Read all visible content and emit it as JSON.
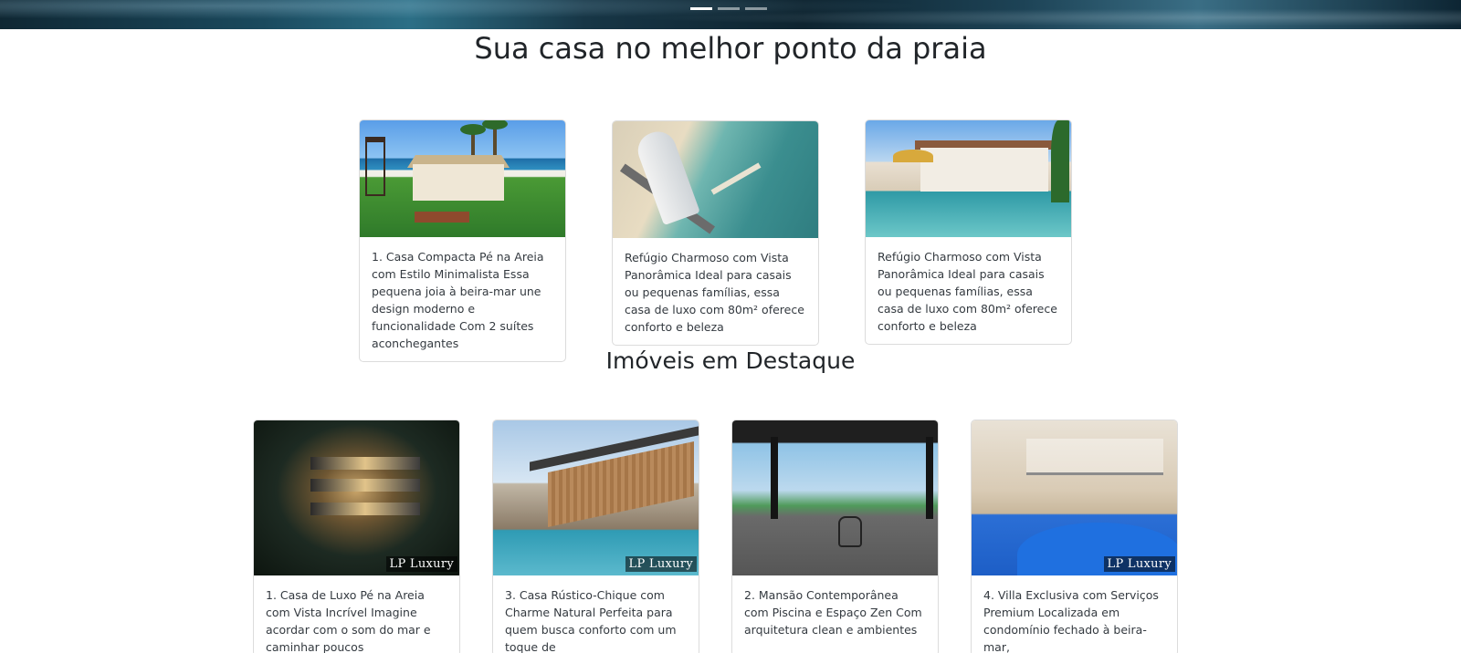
{
  "hero": {
    "indicators": 3,
    "active_index": 0
  },
  "section1": {
    "title": "Sua casa no melhor ponto da praia",
    "cards": [
      {
        "text": "1. Casa Compacta Pé na Areia com Estilo Minimalista Essa pequena joia à beira-mar une design moderno e funcionalidade Com 2 suítes aconchegantes",
        "image": "beach-house-photo"
      },
      {
        "text": "Refúgio Charmoso com Vista Panorâmica Ideal para casais ou pequenas famílias, essa casa de luxo com 80m² oferece conforto e beleza",
        "image": "aerial-coast-photo"
      },
      {
        "text": "Refúgio Charmoso com Vista Panorâmica Ideal para casais ou pequenas famílias, essa casa de luxo com 80m² oferece conforto e beleza",
        "image": "villa-pool-photo"
      }
    ]
  },
  "section2": {
    "title": "Imóveis em Destaque",
    "watermark": "LP Luxury",
    "cards": [
      {
        "text": "1. Casa de Luxo Pé na Areia com Vista Incrível Imagine acordar com o som do mar e caminhar poucos",
        "image": "night-house-photo"
      },
      {
        "text": "3. Casa Rústico-Chique com Charme Natural Perfeita para quem busca conforto com um toque de",
        "image": "modern-wood-house-photo"
      },
      {
        "text": "2. Mansão Contemporânea com Piscina e Espaço Zen Com arquitetura clean e ambientes",
        "image": "deck-sea-view-photo"
      },
      {
        "text": "4. Villa Exclusiva com Serviços Premium Localizada em condomínio fechado à beira-mar,",
        "image": "villa-pool-terrace-photo"
      }
    ]
  }
}
